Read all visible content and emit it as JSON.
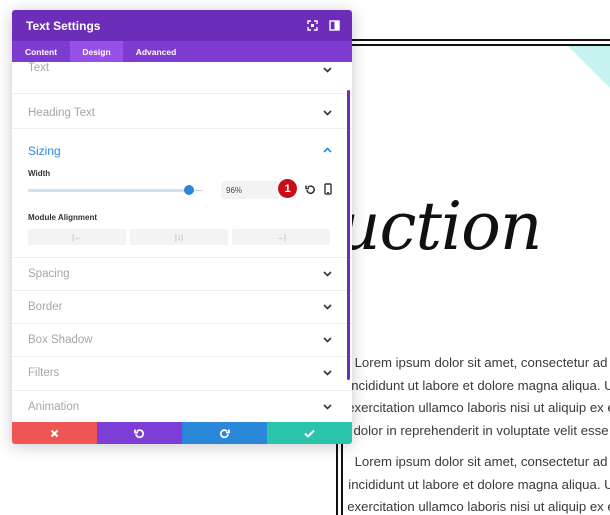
{
  "background": {
    "heading_fragment": "uction",
    "paragraph1": [
      "Lorem ipsum dolor sit amet, consectetur ad",
      "incididunt ut labore et dolore magna aliqua. U",
      "exercitation ullamco laboris nisi ut aliquip ex e",
      "dolor in reprehenderit in voluptate velit esse"
    ],
    "paragraph2": [
      "Lorem ipsum dolor sit amet, consectetur ad",
      "incididunt ut labore et dolore magna aliqua. U",
      "exercitation ullamco laboris nisi ut aliquip ex e"
    ]
  },
  "panel": {
    "title": "Text Settings",
    "tabs": [
      "Content",
      "Design",
      "Advanced"
    ],
    "active_tab": "Design",
    "sections": {
      "text": "Text",
      "heading_text": "Heading Text",
      "sizing": "Sizing",
      "spacing": "Spacing",
      "border": "Border",
      "box_shadow": "Box Shadow",
      "filters": "Filters",
      "animation": "Animation"
    },
    "sizing": {
      "width_label": "Width",
      "width_value": "96%",
      "width_fraction": 0.96,
      "badge_number": "1",
      "module_alignment_label": "Module Alignment",
      "alignment_options": [
        "left",
        "center",
        "right"
      ]
    },
    "footer": [
      "cancel",
      "undo",
      "redo",
      "save"
    ]
  },
  "colors": {
    "header": "#6c2eb9",
    "tabs": "#7e3bd0",
    "active_tab": "#9850e8",
    "accent_blue": "#2b87da",
    "badge_red": "#c60f1b",
    "cancel": "#ef5555",
    "undo": "#7c3ed6",
    "redo": "#2b87da",
    "save": "#29c4a9"
  },
  "icons": {
    "header": [
      "fullscreen-icon",
      "sidebar-toggle-icon"
    ],
    "sizing": [
      "reset-icon",
      "mobile-icon"
    ],
    "chevron": "chevron-icon"
  }
}
